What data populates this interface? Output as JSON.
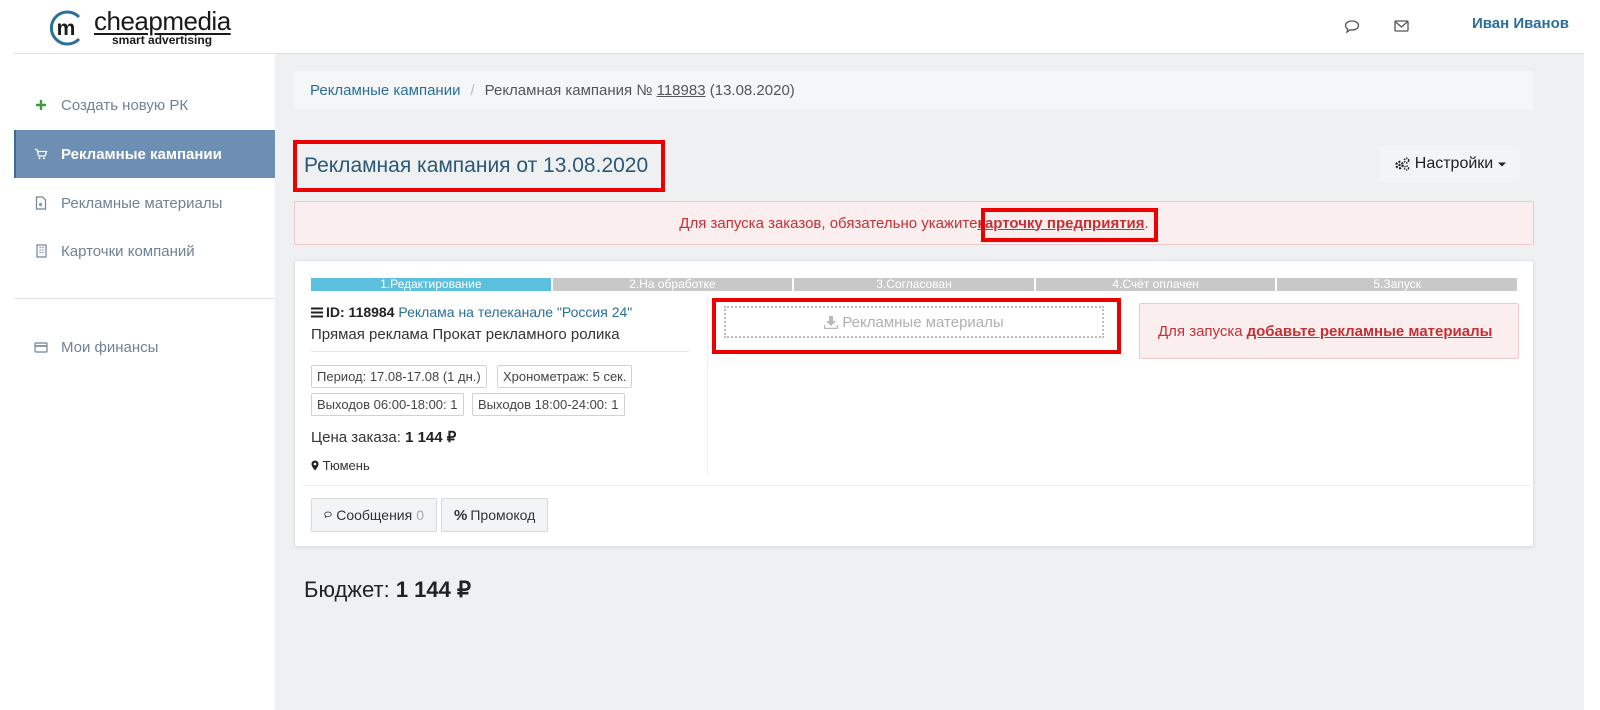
{
  "header": {
    "logo_letter": "m",
    "logo_name": "cheapmedia",
    "logo_tagline": "smart advertising",
    "user_name": "Иван Иванов",
    "icons": [
      "chat-icon",
      "envelope-icon"
    ]
  },
  "sidebar": {
    "items": [
      {
        "label": "Создать новую РК",
        "icon": "plus-icon"
      },
      {
        "label": "Рекламные кампании",
        "icon": "cart-icon",
        "active": true
      },
      {
        "label": "Рекламные материалы",
        "icon": "file-audio-icon"
      },
      {
        "label": "Карточки компаний",
        "icon": "building-icon"
      },
      {
        "label": "Мои финансы",
        "icon": "credit-card-icon"
      }
    ]
  },
  "breadcrumb": {
    "link": "Рекламные кампании",
    "separator": "/",
    "current_prefix": "Рекламная кампания № ",
    "current_id": "118983",
    "current_date": " (13.08.2020)"
  },
  "page": {
    "title": "Рекламная кампания от 13.08.2020",
    "settings_label": "Настройки"
  },
  "alert": {
    "text": "Для запуска заказов, обязательно укажите ",
    "link": "карточку предприятия",
    "suffix": "."
  },
  "order": {
    "steps": [
      "1.Редактирование",
      "2.На обработке",
      "3.Согласован",
      "4.Счёт оплачен",
      "5.Запуск"
    ],
    "active_step": 1,
    "id_label": "ID: 118984",
    "channel": "Реклама на телеканале \"Россия 24\"",
    "type": "Прямая реклама Прокат рекламного ролика",
    "tags": [
      "Период: 17.08-17.08 (1 дн.)",
      "Хронометраж: 5 сек.",
      "Выходов 06:00-18:00: 1",
      "Выходов 18:00-24:00: 1"
    ],
    "price_label": "Цена заказа: ",
    "price_value": "1 144 ₽",
    "city": "Тюмень",
    "materials_button": "Рекламные материалы",
    "notice_text": "Для запуска",
    "notice_link": "добавьте рекламные материалы",
    "messages_label": "Сообщения",
    "messages_count": "0",
    "promo_label": "Промокод"
  },
  "budget": {
    "label": "Бюджет: ",
    "value": "1 144 ₽"
  },
  "colors": {
    "accent": "#2a6f97",
    "sidebar_active": "#6d8fb4",
    "step_active": "#5bc0de",
    "alert_text": "#c53035",
    "annotation": "#ee0000"
  }
}
